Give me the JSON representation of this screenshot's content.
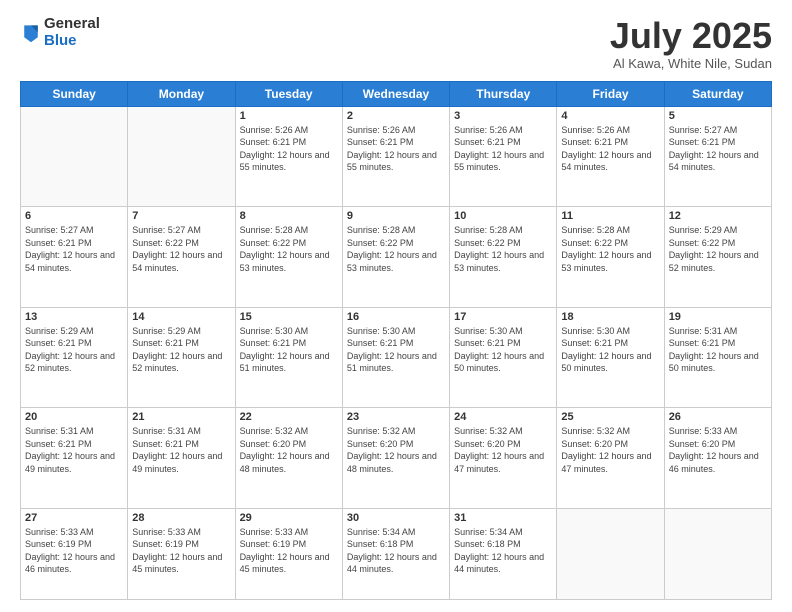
{
  "logo": {
    "general": "General",
    "blue": "Blue"
  },
  "header": {
    "month": "July 2025",
    "location": "Al Kawa, White Nile, Sudan"
  },
  "weekdays": [
    "Sunday",
    "Monday",
    "Tuesday",
    "Wednesday",
    "Thursday",
    "Friday",
    "Saturday"
  ],
  "weeks": [
    [
      {
        "day": "",
        "info": ""
      },
      {
        "day": "",
        "info": ""
      },
      {
        "day": "1",
        "info": "Sunrise: 5:26 AM\nSunset: 6:21 PM\nDaylight: 12 hours and 55 minutes."
      },
      {
        "day": "2",
        "info": "Sunrise: 5:26 AM\nSunset: 6:21 PM\nDaylight: 12 hours and 55 minutes."
      },
      {
        "day": "3",
        "info": "Sunrise: 5:26 AM\nSunset: 6:21 PM\nDaylight: 12 hours and 55 minutes."
      },
      {
        "day": "4",
        "info": "Sunrise: 5:26 AM\nSunset: 6:21 PM\nDaylight: 12 hours and 54 minutes."
      },
      {
        "day": "5",
        "info": "Sunrise: 5:27 AM\nSunset: 6:21 PM\nDaylight: 12 hours and 54 minutes."
      }
    ],
    [
      {
        "day": "6",
        "info": "Sunrise: 5:27 AM\nSunset: 6:21 PM\nDaylight: 12 hours and 54 minutes."
      },
      {
        "day": "7",
        "info": "Sunrise: 5:27 AM\nSunset: 6:22 PM\nDaylight: 12 hours and 54 minutes."
      },
      {
        "day": "8",
        "info": "Sunrise: 5:28 AM\nSunset: 6:22 PM\nDaylight: 12 hours and 53 minutes."
      },
      {
        "day": "9",
        "info": "Sunrise: 5:28 AM\nSunset: 6:22 PM\nDaylight: 12 hours and 53 minutes."
      },
      {
        "day": "10",
        "info": "Sunrise: 5:28 AM\nSunset: 6:22 PM\nDaylight: 12 hours and 53 minutes."
      },
      {
        "day": "11",
        "info": "Sunrise: 5:28 AM\nSunset: 6:22 PM\nDaylight: 12 hours and 53 minutes."
      },
      {
        "day": "12",
        "info": "Sunrise: 5:29 AM\nSunset: 6:22 PM\nDaylight: 12 hours and 52 minutes."
      }
    ],
    [
      {
        "day": "13",
        "info": "Sunrise: 5:29 AM\nSunset: 6:21 PM\nDaylight: 12 hours and 52 minutes."
      },
      {
        "day": "14",
        "info": "Sunrise: 5:29 AM\nSunset: 6:21 PM\nDaylight: 12 hours and 52 minutes."
      },
      {
        "day": "15",
        "info": "Sunrise: 5:30 AM\nSunset: 6:21 PM\nDaylight: 12 hours and 51 minutes."
      },
      {
        "day": "16",
        "info": "Sunrise: 5:30 AM\nSunset: 6:21 PM\nDaylight: 12 hours and 51 minutes."
      },
      {
        "day": "17",
        "info": "Sunrise: 5:30 AM\nSunset: 6:21 PM\nDaylight: 12 hours and 50 minutes."
      },
      {
        "day": "18",
        "info": "Sunrise: 5:30 AM\nSunset: 6:21 PM\nDaylight: 12 hours and 50 minutes."
      },
      {
        "day": "19",
        "info": "Sunrise: 5:31 AM\nSunset: 6:21 PM\nDaylight: 12 hours and 50 minutes."
      }
    ],
    [
      {
        "day": "20",
        "info": "Sunrise: 5:31 AM\nSunset: 6:21 PM\nDaylight: 12 hours and 49 minutes."
      },
      {
        "day": "21",
        "info": "Sunrise: 5:31 AM\nSunset: 6:21 PM\nDaylight: 12 hours and 49 minutes."
      },
      {
        "day": "22",
        "info": "Sunrise: 5:32 AM\nSunset: 6:20 PM\nDaylight: 12 hours and 48 minutes."
      },
      {
        "day": "23",
        "info": "Sunrise: 5:32 AM\nSunset: 6:20 PM\nDaylight: 12 hours and 48 minutes."
      },
      {
        "day": "24",
        "info": "Sunrise: 5:32 AM\nSunset: 6:20 PM\nDaylight: 12 hours and 47 minutes."
      },
      {
        "day": "25",
        "info": "Sunrise: 5:32 AM\nSunset: 6:20 PM\nDaylight: 12 hours and 47 minutes."
      },
      {
        "day": "26",
        "info": "Sunrise: 5:33 AM\nSunset: 6:20 PM\nDaylight: 12 hours and 46 minutes."
      }
    ],
    [
      {
        "day": "27",
        "info": "Sunrise: 5:33 AM\nSunset: 6:19 PM\nDaylight: 12 hours and 46 minutes."
      },
      {
        "day": "28",
        "info": "Sunrise: 5:33 AM\nSunset: 6:19 PM\nDaylight: 12 hours and 45 minutes."
      },
      {
        "day": "29",
        "info": "Sunrise: 5:33 AM\nSunset: 6:19 PM\nDaylight: 12 hours and 45 minutes."
      },
      {
        "day": "30",
        "info": "Sunrise: 5:34 AM\nSunset: 6:18 PM\nDaylight: 12 hours and 44 minutes."
      },
      {
        "day": "31",
        "info": "Sunrise: 5:34 AM\nSunset: 6:18 PM\nDaylight: 12 hours and 44 minutes."
      },
      {
        "day": "",
        "info": ""
      },
      {
        "day": "",
        "info": ""
      }
    ]
  ]
}
